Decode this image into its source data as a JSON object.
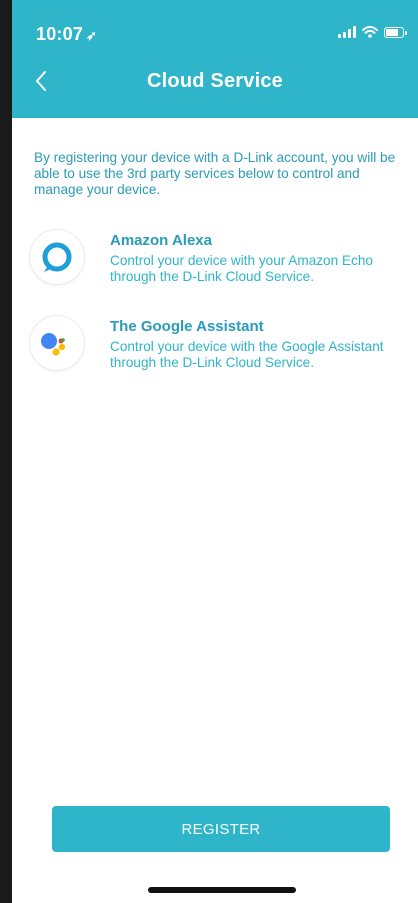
{
  "status_bar": {
    "time": "10:07",
    "location_icon": "location-arrow-icon",
    "signal_icon": "cellular-signal-icon",
    "wifi_icon": "wifi-icon",
    "battery_icon": "battery-icon"
  },
  "header": {
    "title": "Cloud Service",
    "back_icon": "chevron-left-icon",
    "background_color": "#2fb5c9"
  },
  "intro_text": "By registering your device with a D-Link account, you will be able to use the 3rd party services below to control and manage your device.",
  "services": [
    {
      "name": "Amazon Alexa",
      "description": "Control your device with your Amazon Echo through the D-Link Cloud Service.",
      "icon": "amazon-alexa-icon"
    },
    {
      "name": "The Google Assistant",
      "description": "Control your device with the Google Assistant through the D-Link Cloud Service.",
      "icon": "google-assistant-icon"
    }
  ],
  "register_button": {
    "label": "REGISTER",
    "color": "#2fb5c9"
  },
  "colors": {
    "accent": "#2fb5c9",
    "text_accent": "#2a9bb8"
  }
}
